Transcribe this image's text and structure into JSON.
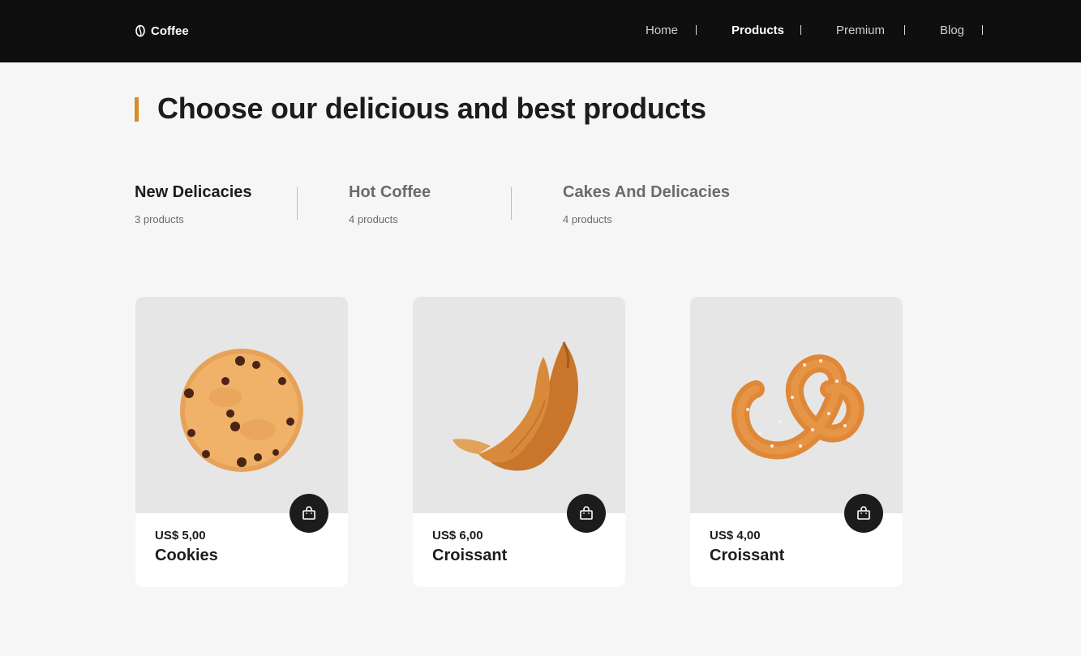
{
  "header": {
    "logo_text": "Coffee",
    "logo_icon": "coffee-bean-icon",
    "nav": [
      {
        "label": "Home",
        "active": false
      },
      {
        "label": "Products",
        "active": true
      },
      {
        "label": "Premium",
        "active": false
      },
      {
        "label": "Blog",
        "active": false
      }
    ]
  },
  "main": {
    "title": "Choose our delicious and best products",
    "accent_color": "#d98a2b",
    "categories": [
      {
        "name": "New Delicacies",
        "count": "3 products",
        "active": true
      },
      {
        "name": "Hot Coffee",
        "count": "4 products",
        "active": false
      },
      {
        "name": "Cakes And Delicacies",
        "count": "4 products",
        "active": false
      }
    ],
    "products": [
      {
        "price": "US$ 5,00",
        "name": "Cookies",
        "image": "cookie-image"
      },
      {
        "price": "US$ 6,00",
        "name": "Croissant",
        "image": "croissant-image"
      },
      {
        "price": "US$ 4,00",
        "name": "Croissant",
        "image": "pretzel-image"
      }
    ],
    "cart_icon": "shopping-bag-icon"
  }
}
